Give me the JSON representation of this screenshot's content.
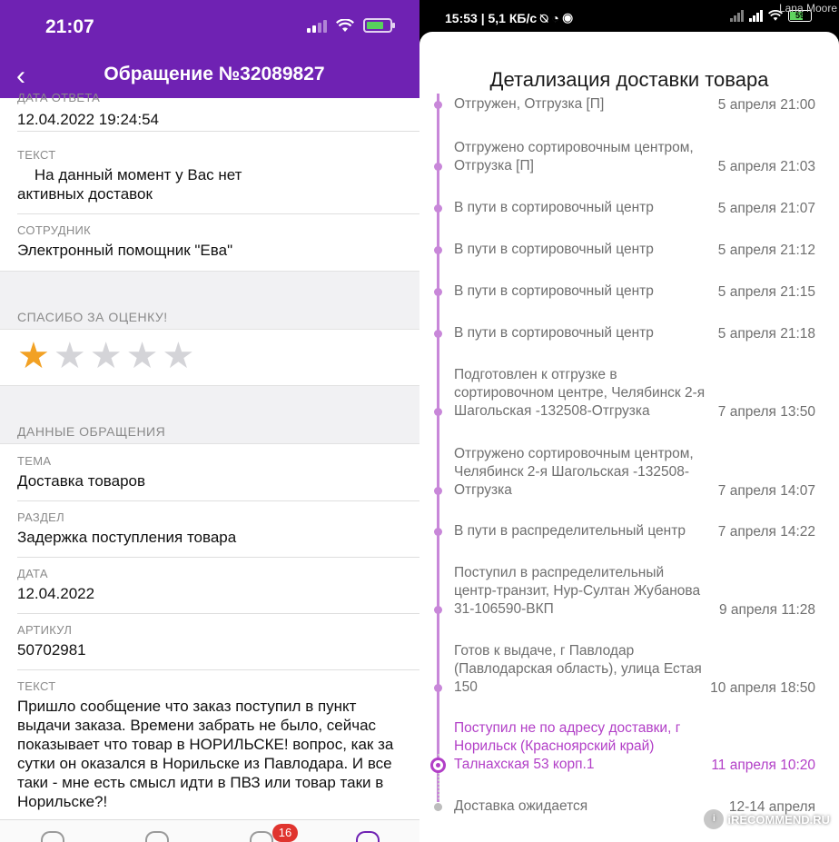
{
  "left": {
    "status_time": "21:07",
    "nav_title": "Обращение №32089827",
    "back_glyph": "‹",
    "fields_top": [
      {
        "label": "ДАТА ОТВЕТА",
        "value": "12.04.2022 19:24:54"
      },
      {
        "label": "ТЕКСТ",
        "value": "    На данный момент у Вас нет активных доставок"
      },
      {
        "label": "СОТРУДНИК",
        "value": "Электронный помощник \"Ева\""
      }
    ],
    "rating_title": "СПАСИБО ЗА ОЦЕНКУ!",
    "rating": {
      "value": 1,
      "max": 5
    },
    "details_title": "ДАННЫЕ ОБРАЩЕНИЯ",
    "fields_details": [
      {
        "label": "ТЕМА",
        "value": "Доставка товаров"
      },
      {
        "label": "РАЗДЕЛ",
        "value": "Задержка поступления товара"
      },
      {
        "label": "ДАТА",
        "value": "12.04.2022"
      },
      {
        "label": "АРТИКУЛ",
        "value": "50702981"
      },
      {
        "label": "ТЕКСТ",
        "value": "Пришло сообщение что заказ поступил в пункт выдачи заказа. Времени забрать не было, сейчас показывает что товар в НОРИЛЬСКЕ! вопрос, как за сутки он оказался в Норильске из Павлодара. И все таки - мне есть смысл идти в ПВЗ или товар таки в Норильске?!"
      }
    ],
    "tab_badge": "16",
    "accent_color": "#6f22b3",
    "star_color": "#f2a124"
  },
  "right": {
    "status_text": "15:53 | 5,1 КБ/с ⍉ ◔ ◉",
    "battery_level": "59",
    "user_name": "Lana Moore",
    "sheet_title": "Детализация доставки товара",
    "events": [
      {
        "text": "Отгружен, Отгрузка [П]",
        "date": "5 апреля 21:00",
        "state": "done"
      },
      {
        "text": "Отгружено сортировочным центром, Отгрузка [П]",
        "date": "5 апреля 21:03",
        "state": "done"
      },
      {
        "text": "В пути в сортировочный центр",
        "date": "5 апреля 21:07",
        "state": "done"
      },
      {
        "text": "В пути в сортировочный центр",
        "date": "5 апреля 21:12",
        "state": "done"
      },
      {
        "text": "В пути в сортировочный центр",
        "date": "5 апреля 21:15",
        "state": "done"
      },
      {
        "text": "В пути в сортировочный центр",
        "date": "5 апреля 21:18",
        "state": "done"
      },
      {
        "text": "Подготовлен к отгрузке в сортировочном центре, Челябинск 2-я Шагольская -132508-Отгрузка",
        "date": "7 апреля 13:50",
        "state": "done"
      },
      {
        "text": "Отгружено сортировочным центром, Челябинск 2-я Шагольская -132508-Отгрузка",
        "date": "7 апреля 14:07",
        "state": "done"
      },
      {
        "text": "В пути в распределительный центр",
        "date": "7 апреля 14:22",
        "state": "done"
      },
      {
        "text": "Поступил в распределительный центр-транзит, Нур-Султан Жубанова 31-106590-ВКП",
        "date": "9 апреля 11:28",
        "state": "done"
      },
      {
        "text": "Готов к выдаче, г Павлодар (Павлодарская область), улица Естая 150",
        "date": "10 апреля 18:50",
        "state": "done"
      },
      {
        "text": "Поступил не по адресу доставки, г Норильск (Красноярский край) Талнахская 53 корп.1",
        "date": "11 апреля 10:20",
        "state": "current"
      },
      {
        "text": "Доставка ожидается",
        "date": "12-14 апреля",
        "state": "pending"
      }
    ],
    "timeline_color": "#c887d9",
    "active_color": "#b23fc7",
    "watermark": "iRECOMMEND.RU"
  }
}
